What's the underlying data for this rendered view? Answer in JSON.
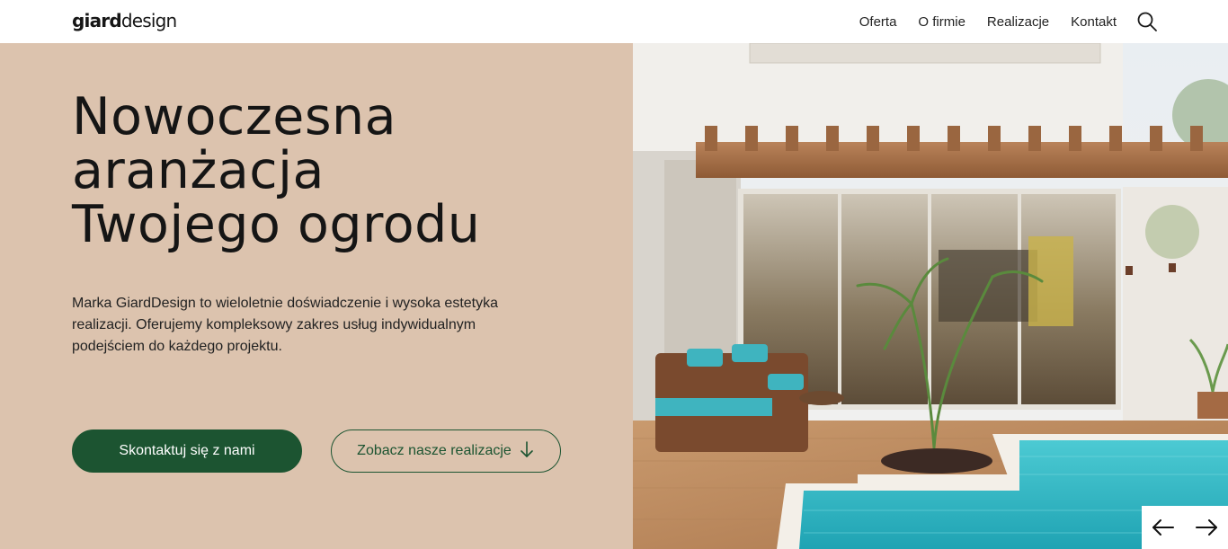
{
  "header": {
    "logo_bold": "giard",
    "logo_regular": "design",
    "nav": [
      "Oferta",
      "O firmie",
      "Realizacje",
      "Kontakt"
    ],
    "search_icon": "search-icon"
  },
  "hero": {
    "title_lines": [
      "Nowoczesna",
      "aranżacja",
      "Twojego ogrodu"
    ],
    "description": "Marka GiardDesign to wieloletnie doświadczenie i wysoka estetyka realizacji. Oferujemy kompleksowy zakres usług indywidualnym podejściem do każdego projektu.",
    "primary_cta": "Skontaktuj się z nami",
    "secondary_cta": "Zobacz nasze realizacje",
    "secondary_icon": "arrow-down-icon"
  },
  "slider": {
    "prev_icon": "arrow-left-icon",
    "next_icon": "arrow-right-icon"
  },
  "colors": {
    "hero_bg": "#dcc3ae",
    "brand_green": "#1c5431",
    "pool": "#2fb3c0"
  }
}
